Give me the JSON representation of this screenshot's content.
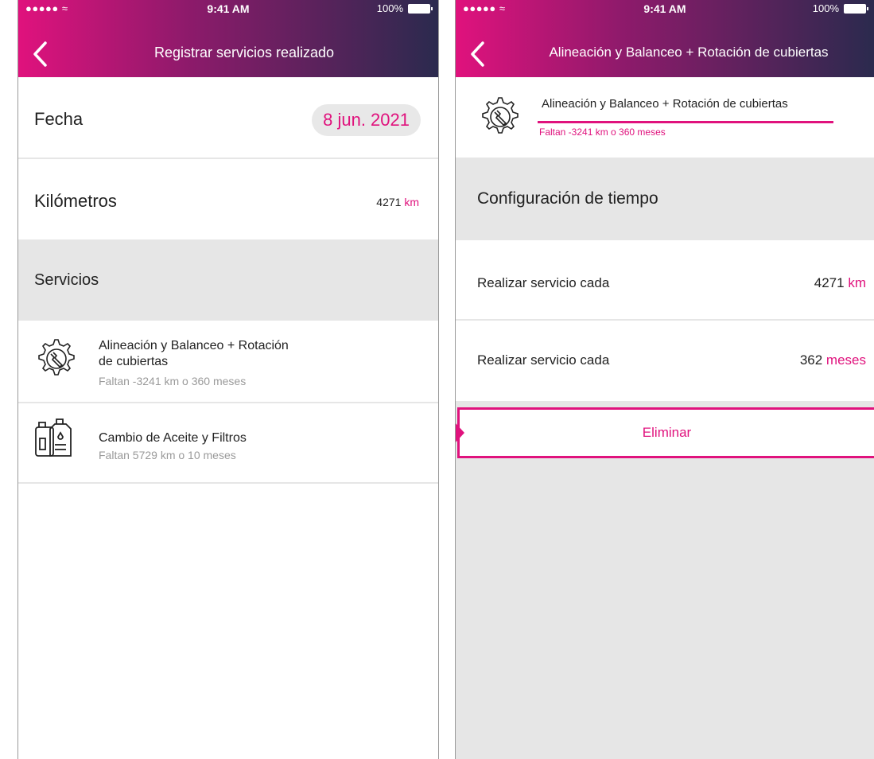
{
  "status_bar": {
    "signal": "●●●●● ",
    "wifi": "≈",
    "time": "9:41 AM",
    "battery": "100%"
  },
  "screen1": {
    "nav_title": "Registrar servicios realizado",
    "fecha_label": "Fecha",
    "fecha_value": "8 jun. 2021",
    "km_label": "Kilómetros",
    "km_value": "4271",
    "km_unit": "km",
    "servicios_label": "Servicios",
    "services": [
      {
        "icon": "gear-wrench-icon",
        "title_line1": "Alineación y Balanceo + Rotación",
        "title_line2": "de cubiertas",
        "subtitle": "Faltan -3241 km o 360 meses"
      },
      {
        "icon": "oil-can-icon",
        "title_line1": "Cambio de Aceite y Filtros",
        "subtitle": "Faltan 5729 km o 10 meses"
      }
    ]
  },
  "screen2": {
    "nav_title": "Alineación y Balanceo + Rotación de cubiertas",
    "card_title": "Alineación y Balanceo + Rotación de cubiertas",
    "card_subtitle": "Faltan -3241 km o 360 meses",
    "config_label": "Configuración de tiempo",
    "rows": [
      {
        "label": "Realizar servicio cada",
        "value": "4271",
        "unit": "km"
      },
      {
        "label": "Realizar servicio cada",
        "value": "362",
        "unit": "meses"
      }
    ],
    "delete_label": "Eliminar"
  },
  "colors": {
    "accent": "#e0127d",
    "nav_gradient_start": "#e0127d",
    "nav_gradient_end": "#2b2a4e",
    "section_bg": "#e6e6e6"
  }
}
